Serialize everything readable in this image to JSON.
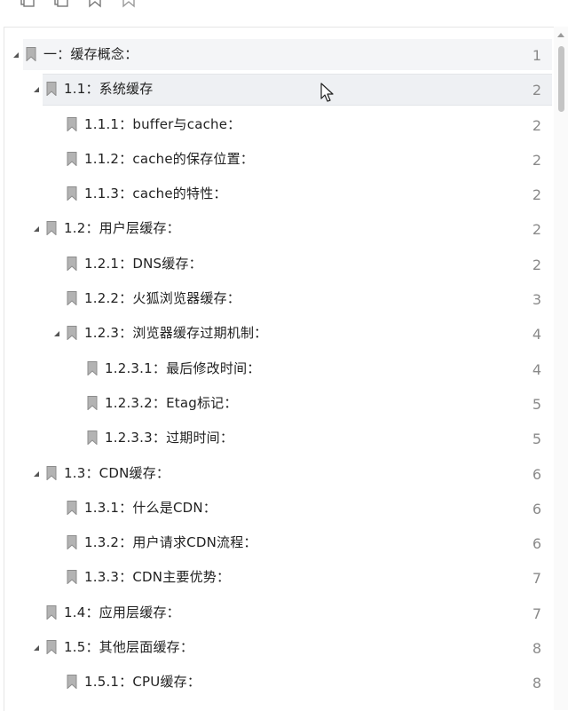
{
  "outline": {
    "items": [
      {
        "label": "一：缓存概念：",
        "page": "1",
        "level": 0,
        "expanded": true,
        "state": "hover"
      },
      {
        "label": "1.1：系统缓存",
        "page": "2",
        "level": 1,
        "expanded": true,
        "state": "selected"
      },
      {
        "label": "1.1.1：buffer与cache：",
        "page": "2",
        "level": 2,
        "expanded": null,
        "state": ""
      },
      {
        "label": "1.1.2：cache的保存位置：",
        "page": "2",
        "level": 2,
        "expanded": null,
        "state": ""
      },
      {
        "label": "1.1.3：cache的特性：",
        "page": "2",
        "level": 2,
        "expanded": null,
        "state": ""
      },
      {
        "label": "1.2：用户层缓存：",
        "page": "2",
        "level": 1,
        "expanded": true,
        "state": ""
      },
      {
        "label": "1.2.1：DNS缓存：",
        "page": "2",
        "level": 2,
        "expanded": null,
        "state": ""
      },
      {
        "label": "1.2.2：火狐浏览器缓存：",
        "page": "3",
        "level": 2,
        "expanded": null,
        "state": ""
      },
      {
        "label": "1.2.3：浏览器缓存过期机制：",
        "page": "4",
        "level": 2,
        "expanded": true,
        "state": ""
      },
      {
        "label": "1.2.3.1：最后修改时间：",
        "page": "4",
        "level": 3,
        "expanded": null,
        "state": ""
      },
      {
        "label": "1.2.3.2：Etag标记：",
        "page": "5",
        "level": 3,
        "expanded": null,
        "state": ""
      },
      {
        "label": "1.2.3.3：过期时间：",
        "page": "5",
        "level": 3,
        "expanded": null,
        "state": ""
      },
      {
        "label": "1.3：CDN缓存：",
        "page": "6",
        "level": 1,
        "expanded": true,
        "state": ""
      },
      {
        "label": "1.3.1：什么是CDN：",
        "page": "6",
        "level": 2,
        "expanded": null,
        "state": ""
      },
      {
        "label": "1.3.2：用户请求CDN流程：",
        "page": "6",
        "level": 2,
        "expanded": null,
        "state": ""
      },
      {
        "label": "1.3.3：CDN主要优势：",
        "page": "7",
        "level": 2,
        "expanded": null,
        "state": ""
      },
      {
        "label": "1.4：应用层缓存：",
        "page": "7",
        "level": 1,
        "expanded": null,
        "state": ""
      },
      {
        "label": "1.5：其他层面缓存：",
        "page": "8",
        "level": 1,
        "expanded": true,
        "state": ""
      },
      {
        "label": "1.5.1：CPU缓存：",
        "page": "8",
        "level": 2,
        "expanded": null,
        "state": ""
      }
    ]
  },
  "colors": {
    "bookmark": "#8c8c8c",
    "toggle": "#555555",
    "page_number": "#8a8a8a",
    "selected_bg": "#eef0f3"
  },
  "icons": {
    "toolbar": [
      "expand-all-icon",
      "collapse-all-icon",
      "add-bookmark-icon",
      "remove-bookmark-icon"
    ],
    "row": "bookmark-icon",
    "toggle_expanded": "triangle-down-icon"
  }
}
